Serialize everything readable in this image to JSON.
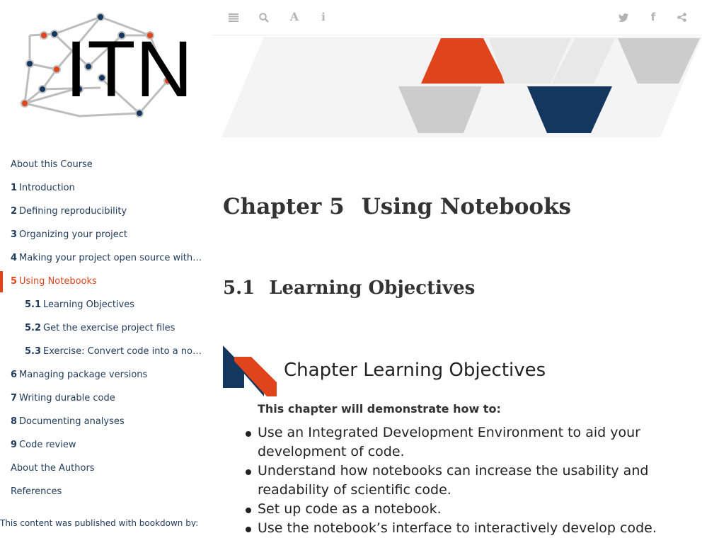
{
  "toolbar": {
    "left_icons": [
      "toc-toggle-icon",
      "search-icon",
      "font-settings-icon",
      "info-icon"
    ],
    "right_icons": [
      "twitter-icon",
      "facebook-icon",
      "share-icon"
    ]
  },
  "logo": {
    "text": "ITN"
  },
  "toc": [
    {
      "num": "",
      "label": "About this Course",
      "level": 1
    },
    {
      "num": "1",
      "label": "Introduction",
      "level": 1
    },
    {
      "num": "2",
      "label": "Defining reproducibility",
      "level": 1
    },
    {
      "num": "3",
      "label": "Organizing your project",
      "level": 1
    },
    {
      "num": "4",
      "label": "Making your project open source with …",
      "level": 1
    },
    {
      "num": "5",
      "label": "Using Notebooks",
      "level": 1,
      "active": true
    },
    {
      "num": "5.1",
      "label": "Learning Objectives",
      "level": 2
    },
    {
      "num": "5.2",
      "label": "Get the exercise project files",
      "level": 2
    },
    {
      "num": "5.3",
      "label": "Exercise: Convert code into a note…",
      "level": 2
    },
    {
      "num": "6",
      "label": "Managing package versions",
      "level": 1
    },
    {
      "num": "7",
      "label": "Writing durable code",
      "level": 1
    },
    {
      "num": "8",
      "label": "Documenting analyses",
      "level": 1
    },
    {
      "num": "9",
      "label": "Code review",
      "level": 1
    },
    {
      "num": "",
      "label": "About the Authors",
      "level": 1
    },
    {
      "num": "",
      "label": "References",
      "level": 1
    }
  ],
  "published_note": "This content was published with bookdown by:",
  "chapter": {
    "label": "Chapter 5",
    "title": "Using Notebooks"
  },
  "section": {
    "number": "5.1",
    "title": "Learning Objectives"
  },
  "objectives": {
    "title": "Chapter Learning Objectives",
    "intro": "This chapter will demonstrate how to:",
    "items": [
      "Use an Integrated Development Environment to aid your development of code.",
      "Understand how notebooks can increase the usability and readability of scientific code.",
      "Set up code as a notebook.",
      "Use the notebook’s interface to interactively develop code."
    ]
  },
  "colors": {
    "accent": "#e0441b",
    "navy": "#13375e",
    "gray": "#cccccc"
  }
}
